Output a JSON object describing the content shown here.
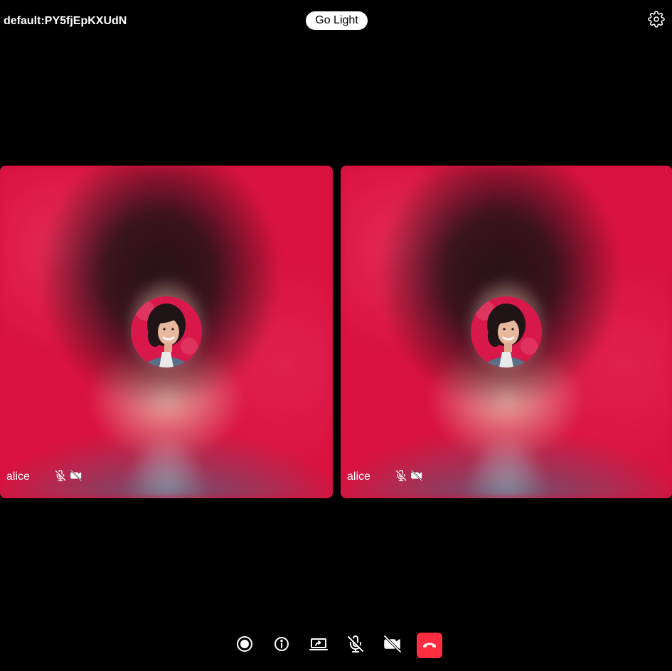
{
  "header": {
    "room_name": "default:PY5fjEpKXUdN",
    "theme_toggle_label": "Go Light",
    "settings_icon": "gear-icon"
  },
  "participants": [
    {
      "name": "alice",
      "mic_muted": true,
      "camera_off": true,
      "status_icons": [
        "mic-off-icon",
        "video-off-icon"
      ]
    },
    {
      "name": "alice",
      "mic_muted": true,
      "camera_off": true,
      "status_icons": [
        "mic-off-icon",
        "video-off-icon"
      ]
    }
  ],
  "controls": [
    {
      "icon": "record-icon",
      "action": "record"
    },
    {
      "icon": "info-icon",
      "action": "info"
    },
    {
      "icon": "screen-share-icon",
      "action": "share-screen"
    },
    {
      "icon": "mic-off-icon",
      "action": "toggle-mic"
    },
    {
      "icon": "video-off-icon",
      "action": "toggle-camera"
    },
    {
      "icon": "phone-hangup-icon",
      "action": "leave"
    }
  ],
  "colors": {
    "background": "#000000",
    "text": "#ffffff",
    "leave_button": "#ff2d3f",
    "tile_background": "#d9123f"
  }
}
